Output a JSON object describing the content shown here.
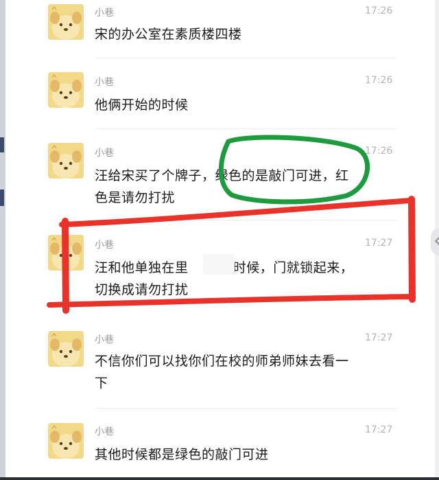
{
  "messages": [
    {
      "sender": "小巷",
      "time": "17:26",
      "lines": [
        "宋的办公室在素质楼四楼"
      ]
    },
    {
      "sender": "小巷",
      "time": "17:26",
      "lines": [
        "他俩开始的时候"
      ]
    },
    {
      "sender": "小巷",
      "time": "17:26",
      "lines": [
        "汪给宋买了个牌子，绿色的是敲门可进，红",
        "色是请勿打扰"
      ]
    },
    {
      "sender": "小巷",
      "time": "17:27",
      "lines": [
        "汪和他单独在里       的时候，门就锁起来，",
        "切换成请勿打扰"
      ]
    },
    {
      "sender": "小巷",
      "time": "17:27",
      "lines": [
        "不信你们可以找你们在校的师弟师妹去看一",
        "下"
      ]
    },
    {
      "sender": "小巷",
      "time": "17:27",
      "lines": [
        "其他时候都是绿色的敲门可进"
      ]
    }
  ],
  "avatar": {
    "icon": "cartoon-dog-avatar",
    "bg_color": "#f2d98a"
  },
  "annotations": {
    "circle_color": "#1e9b3e",
    "box_color": "#e8322a"
  }
}
